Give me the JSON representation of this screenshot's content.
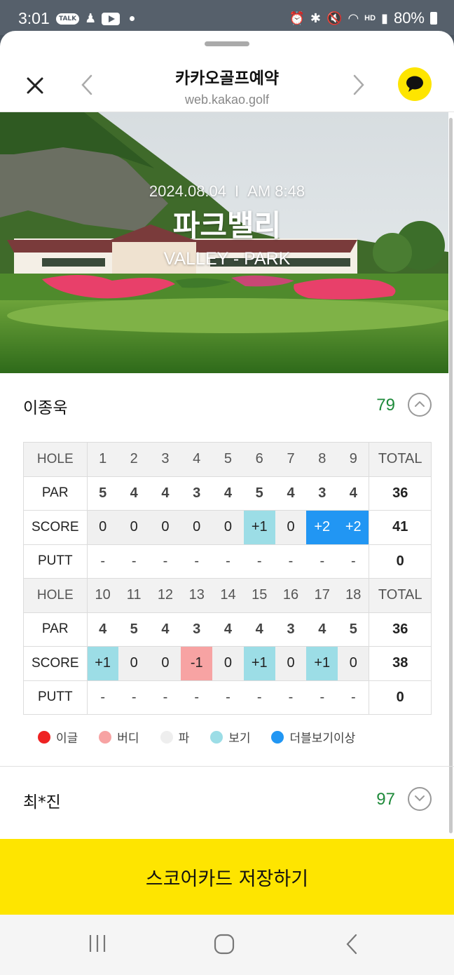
{
  "status_bar": {
    "time": "3:01",
    "talk_badge": "TALK",
    "hd_badge": "HD",
    "battery": "80%"
  },
  "header": {
    "title": "카카오골프예약",
    "url": "web.kakao.golf"
  },
  "hero": {
    "date": "2024.08.04",
    "separator": "I",
    "time": "AM 8:48",
    "course": "파크밸리",
    "sub_course": "VALLEY - PARK"
  },
  "players": [
    {
      "name": "이종욱",
      "total": "79",
      "expanded": true
    },
    {
      "name": "최*진",
      "total": "97",
      "expanded": false
    }
  ],
  "scorecard": {
    "labels": {
      "hole": "HOLE",
      "par": "PAR",
      "score": "SCORE",
      "putt": "PUTT",
      "total": "TOTAL"
    },
    "front": {
      "holes": [
        "1",
        "2",
        "3",
        "4",
        "5",
        "6",
        "7",
        "8",
        "9"
      ],
      "par": [
        "5",
        "4",
        "4",
        "3",
        "4",
        "5",
        "4",
        "3",
        "4"
      ],
      "par_total": "36",
      "score": [
        "0",
        "0",
        "0",
        "0",
        "0",
        "+1",
        "0",
        "+2",
        "+2"
      ],
      "score_total": "41",
      "putt": [
        "-",
        "-",
        "-",
        "-",
        "-",
        "-",
        "-",
        "-",
        "-"
      ],
      "putt_total": "0"
    },
    "back": {
      "holes": [
        "10",
        "11",
        "12",
        "13",
        "14",
        "15",
        "16",
        "17",
        "18"
      ],
      "par": [
        "4",
        "5",
        "4",
        "3",
        "4",
        "4",
        "3",
        "4",
        "5"
      ],
      "par_total": "36",
      "score": [
        "+1",
        "0",
        "0",
        "-1",
        "0",
        "+1",
        "0",
        "+1",
        "0"
      ],
      "score_total": "38",
      "putt": [
        "-",
        "-",
        "-",
        "-",
        "-",
        "-",
        "-",
        "-",
        "-"
      ],
      "putt_total": "0"
    }
  },
  "legend": [
    {
      "label": "이글",
      "color": "#ee2222",
      "key": "eagle"
    },
    {
      "label": "버디",
      "color": "#f7a3a3",
      "key": "birdie"
    },
    {
      "label": "파",
      "color": "#eeeeee",
      "key": "par"
    },
    {
      "label": "보기",
      "color": "#9cdde6",
      "key": "bogey"
    },
    {
      "label": "더블보기이상",
      "color": "#2196f3",
      "key": "double"
    }
  ],
  "colors": {
    "accent_yellow": "#fee500",
    "score_green": "#1e8a3a"
  },
  "save_button": "스코어카드 저장하기"
}
